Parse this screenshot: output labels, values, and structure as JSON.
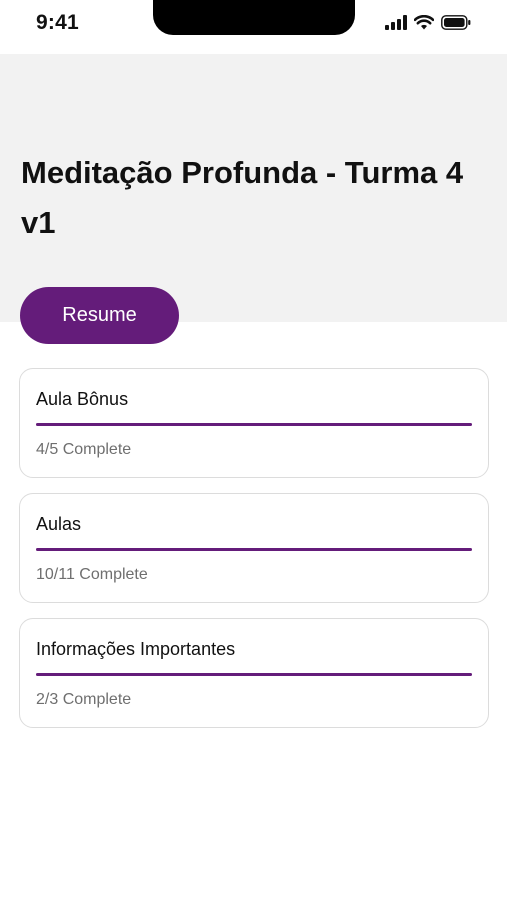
{
  "status_bar": {
    "time": "9:41",
    "icons": [
      "cellular-signal-icon",
      "wifi-icon",
      "battery-icon"
    ]
  },
  "course": {
    "title": "Meditação Profunda - Turma 4 v1",
    "resume_label": "Resume"
  },
  "modules": [
    {
      "name": "Aula Bônus",
      "status": "4/5 Complete",
      "progress": 1.0
    },
    {
      "name": "Aulas",
      "status": "10/11 Complete",
      "progress": 1.0
    },
    {
      "name": "Informações Importantes",
      "status": "2/3 Complete",
      "progress": 1.0
    }
  ],
  "colors": {
    "accent": "#641c7a",
    "header_background": "#f2f2f2",
    "card_border": "#dcdcdc",
    "secondary_text": "#6f6f6f"
  }
}
